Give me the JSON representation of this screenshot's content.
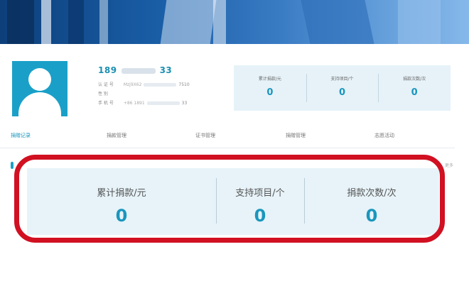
{
  "user": {
    "id_start": "189",
    "id_end": "33",
    "fields": [
      {
        "label": "认 证 号",
        "value": "Mzj9X62",
        "value_end": "7510"
      },
      {
        "label": "性 别",
        "value": ""
      },
      {
        "label": "手 机 号",
        "value": "+86 1891",
        "value_end": "33"
      }
    ]
  },
  "mini_stats": [
    {
      "label": "累计捐款/元",
      "value": "0"
    },
    {
      "label": "支持项目/个",
      "value": "0"
    },
    {
      "label": "捐款次数/次",
      "value": "0"
    }
  ],
  "tabs": [
    "捐赠记录",
    "捐款管理",
    "证书管理",
    "捐赠管理",
    "志愿活动"
  ],
  "more_label": "更多",
  "big_stats": [
    {
      "label": "累计捐款/元",
      "value": "0"
    },
    {
      "label": "支持项目/个",
      "value": "0"
    },
    {
      "label": "捐款次数/次",
      "value": "0"
    }
  ],
  "colors": {
    "accent": "#1a96bd",
    "highlight": "#d11022",
    "stats_bg": "#e7f3f9"
  }
}
